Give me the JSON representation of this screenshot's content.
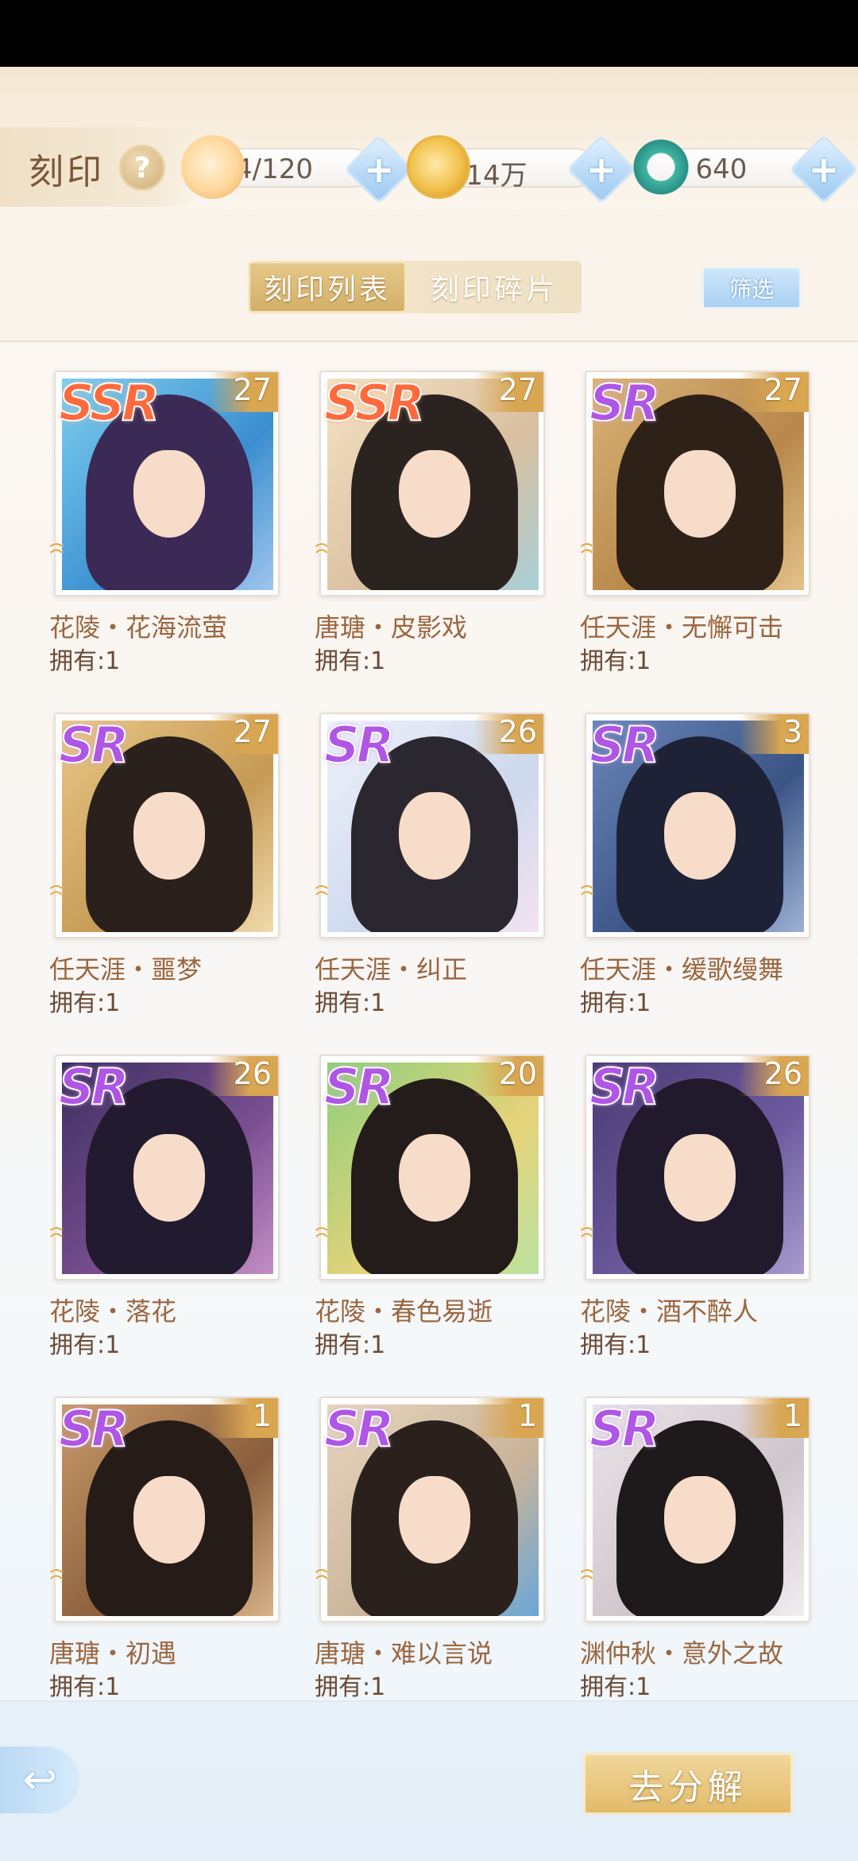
{
  "header": {
    "title": "刻印",
    "help_label": "?",
    "currencies": [
      {
        "icon": "cat-icon",
        "value": "4/120"
      },
      {
        "icon": "paw-coin-icon",
        "value": "14万"
      },
      {
        "icon": "jade-dragon-icon",
        "value": "640"
      }
    ],
    "plus_label": "+"
  },
  "tabs": [
    {
      "label": "刻印列表",
      "active": true
    },
    {
      "label": "刻印碎片",
      "active": false
    }
  ],
  "filter_label": "筛选",
  "cards": [
    {
      "rarity": "SSR",
      "level": "27",
      "name": "花陵・花海流萤",
      "owned": "拥有:1",
      "swirls": "ꩰꩰ"
    },
    {
      "rarity": "SSR",
      "level": "27",
      "name": "唐瑭・皮影戏",
      "owned": "拥有:1",
      "swirls": "ꩰ"
    },
    {
      "rarity": "SR",
      "level": "27",
      "name": "任天涯・无懈可击",
      "owned": "拥有:1",
      "swirls": "ꩰꩰ"
    },
    {
      "rarity": "SR",
      "level": "27",
      "name": "任天涯・噩梦",
      "owned": "拥有:1",
      "swirls": "ꩰ"
    },
    {
      "rarity": "SR",
      "level": "26",
      "name": "任天涯・纠正",
      "owned": "拥有:1",
      "swirls": "ꩰ"
    },
    {
      "rarity": "SR",
      "level": "3",
      "name": "任天涯・缓歌缦舞",
      "owned": "拥有:1",
      "swirls": "ꩰ"
    },
    {
      "rarity": "SR",
      "level": "26",
      "name": "花陵・落花",
      "owned": "拥有:1",
      "swirls": "ꩰ"
    },
    {
      "rarity": "SR",
      "level": "20",
      "name": "花陵・春色易逝",
      "owned": "拥有:1",
      "swirls": "ꩰ"
    },
    {
      "rarity": "SR",
      "level": "26",
      "name": "花陵・酒不醉人",
      "owned": "拥有:1",
      "swirls": "ꩰ"
    },
    {
      "rarity": "SR",
      "level": "1",
      "name": "唐瑭・初遇",
      "owned": "拥有:1",
      "swirls": "ꩰ"
    },
    {
      "rarity": "SR",
      "level": "1",
      "name": "唐瑭・难以言说",
      "owned": "拥有:1",
      "swirls": "ꩰ"
    },
    {
      "rarity": "SR",
      "level": "1",
      "name": "渊仲秋・意外之故",
      "owned": "拥有:1",
      "swirls": "ꩰ"
    }
  ],
  "bottom": {
    "back_icon": "back-arrow-icon",
    "back_label": "↩",
    "decompose_label": "去分解"
  }
}
